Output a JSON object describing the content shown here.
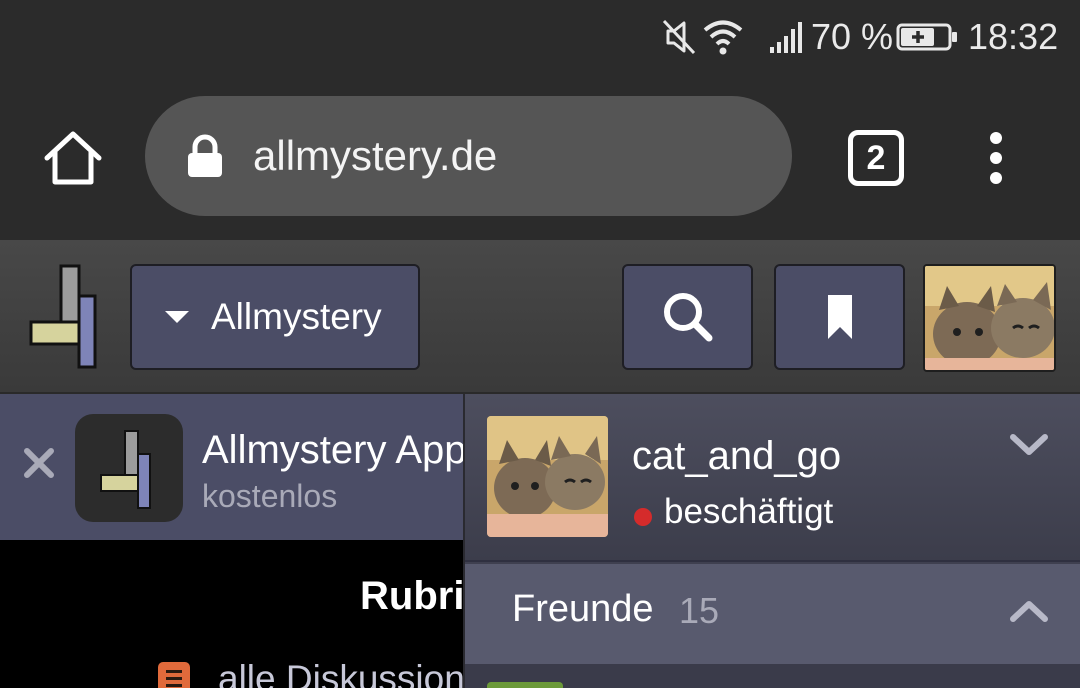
{
  "statusbar": {
    "mute_icon": "muted-speaker-icon",
    "wifi_icon": "wifi-icon",
    "signal_icon": "signal-bars-icon",
    "battery_percent": "70 %",
    "battery_icon": "battery-charging-icon",
    "time": "18:32"
  },
  "browser": {
    "home_icon": "home-icon",
    "lock_icon": "lock-icon",
    "url": "allmystery.de",
    "tab_count": "2",
    "menu_icon": "more-vertical-icon"
  },
  "site_header": {
    "logo_icon": "allmystery-logo-icon",
    "nav_label": "Allmystery",
    "search_icon": "search-icon",
    "bookmark_icon": "bookmark-icon",
    "avatar": "user-avatar-kittens"
  },
  "app_banner": {
    "close_icon": "close-icon",
    "title": "Allmystery App",
    "subtitle": "kostenlos"
  },
  "main": {
    "section_title": "Rubriken",
    "link_all_discussions": "alle Diskussionen"
  },
  "user_panel": {
    "username": "cat_and_go",
    "status": "beschäftigt",
    "status_color": "#d52b2b",
    "friends_label": "Freunde",
    "friends_count": "15"
  },
  "colors": {
    "chrome_bg": "#2b2b2b",
    "urlbar_bg": "#555555",
    "button_bg": "#4b4d66",
    "panel_bg": "#3f4050",
    "friends_bg": "#585a6e"
  }
}
